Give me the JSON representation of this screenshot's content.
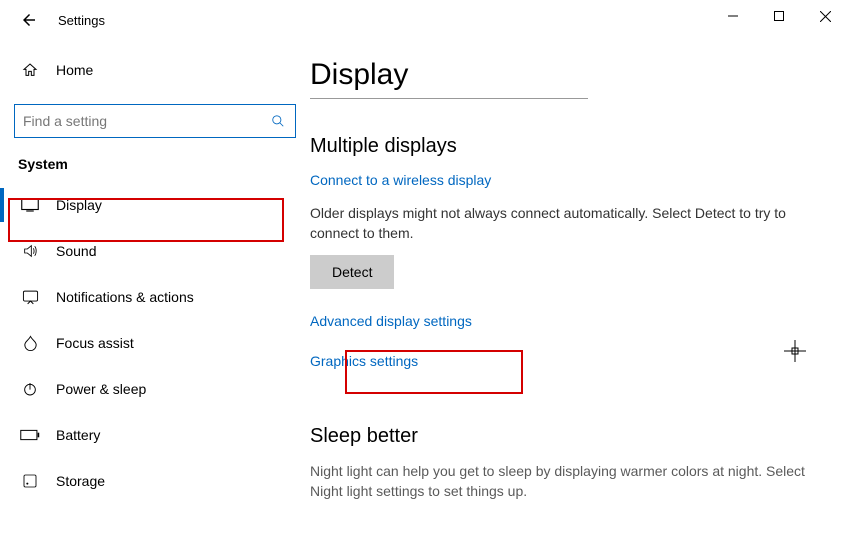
{
  "app": {
    "title": "Settings"
  },
  "sidebar": {
    "home": "Home",
    "search_placeholder": "Find a setting",
    "category": "System",
    "items": [
      {
        "label": "Display"
      },
      {
        "label": "Sound"
      },
      {
        "label": "Notifications & actions"
      },
      {
        "label": "Focus assist"
      },
      {
        "label": "Power & sleep"
      },
      {
        "label": "Battery"
      },
      {
        "label": "Storage"
      }
    ]
  },
  "main": {
    "title": "Display",
    "multi": {
      "heading": "Multiple displays",
      "wireless_link": "Connect to a wireless display",
      "detect_desc": "Older displays might not always connect automatically. Select Detect to try to connect to them.",
      "detect_btn": "Detect",
      "advanced_link": "Advanced display settings",
      "graphics_link": "Graphics settings"
    },
    "sleep": {
      "heading": "Sleep better",
      "desc": "Night light can help you get to sleep by displaying warmer colors at night. Select Night light settings to set things up."
    }
  }
}
